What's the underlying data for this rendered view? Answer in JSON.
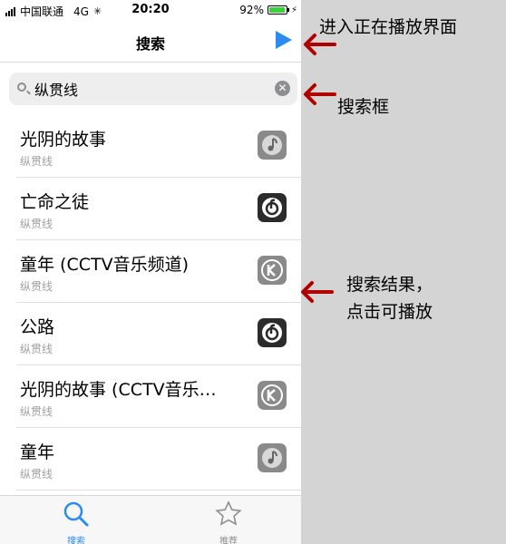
{
  "status_bar": {
    "carrier": "中国联通",
    "network": "4G",
    "time": "20:20",
    "battery": "92%",
    "battery_level": 0.92
  },
  "nav": {
    "title": "搜索"
  },
  "search": {
    "value": "纵贯线"
  },
  "results": [
    {
      "title": "光阴的故事",
      "artist": "纵贯线",
      "icon": "music-note-icon",
      "icon_color": "#8a8a8a"
    },
    {
      "title": "亡命之徒",
      "artist": "纵贯线",
      "icon": "netease-music-icon",
      "icon_color": "#2b2b2b"
    },
    {
      "title": "童年 (CCTV音乐频道)",
      "artist": "纵贯线",
      "icon": "kuwo-k-icon",
      "icon_color": "#8a8a8a"
    },
    {
      "title": "公路",
      "artist": "纵贯线",
      "icon": "netease-music-icon",
      "icon_color": "#2b2b2b"
    },
    {
      "title": "光阴的故事 (CCTV音乐…",
      "artist": "纵贯线",
      "icon": "kuwo-k-icon",
      "icon_color": "#8a8a8a"
    },
    {
      "title": "童年",
      "artist": "纵贯线",
      "icon": "music-note-icon",
      "icon_color": "#8a8a8a"
    }
  ],
  "tabbar": {
    "search": "搜索",
    "recommend": "推荐",
    "active_color": "#2a8bf2"
  },
  "annotations": {
    "now_playing": "进入正在播放界面",
    "search_box": "搜索框",
    "results_line1": "搜索结果，",
    "results_line2": "点击可播放",
    "arrow_color": "#b00000"
  }
}
